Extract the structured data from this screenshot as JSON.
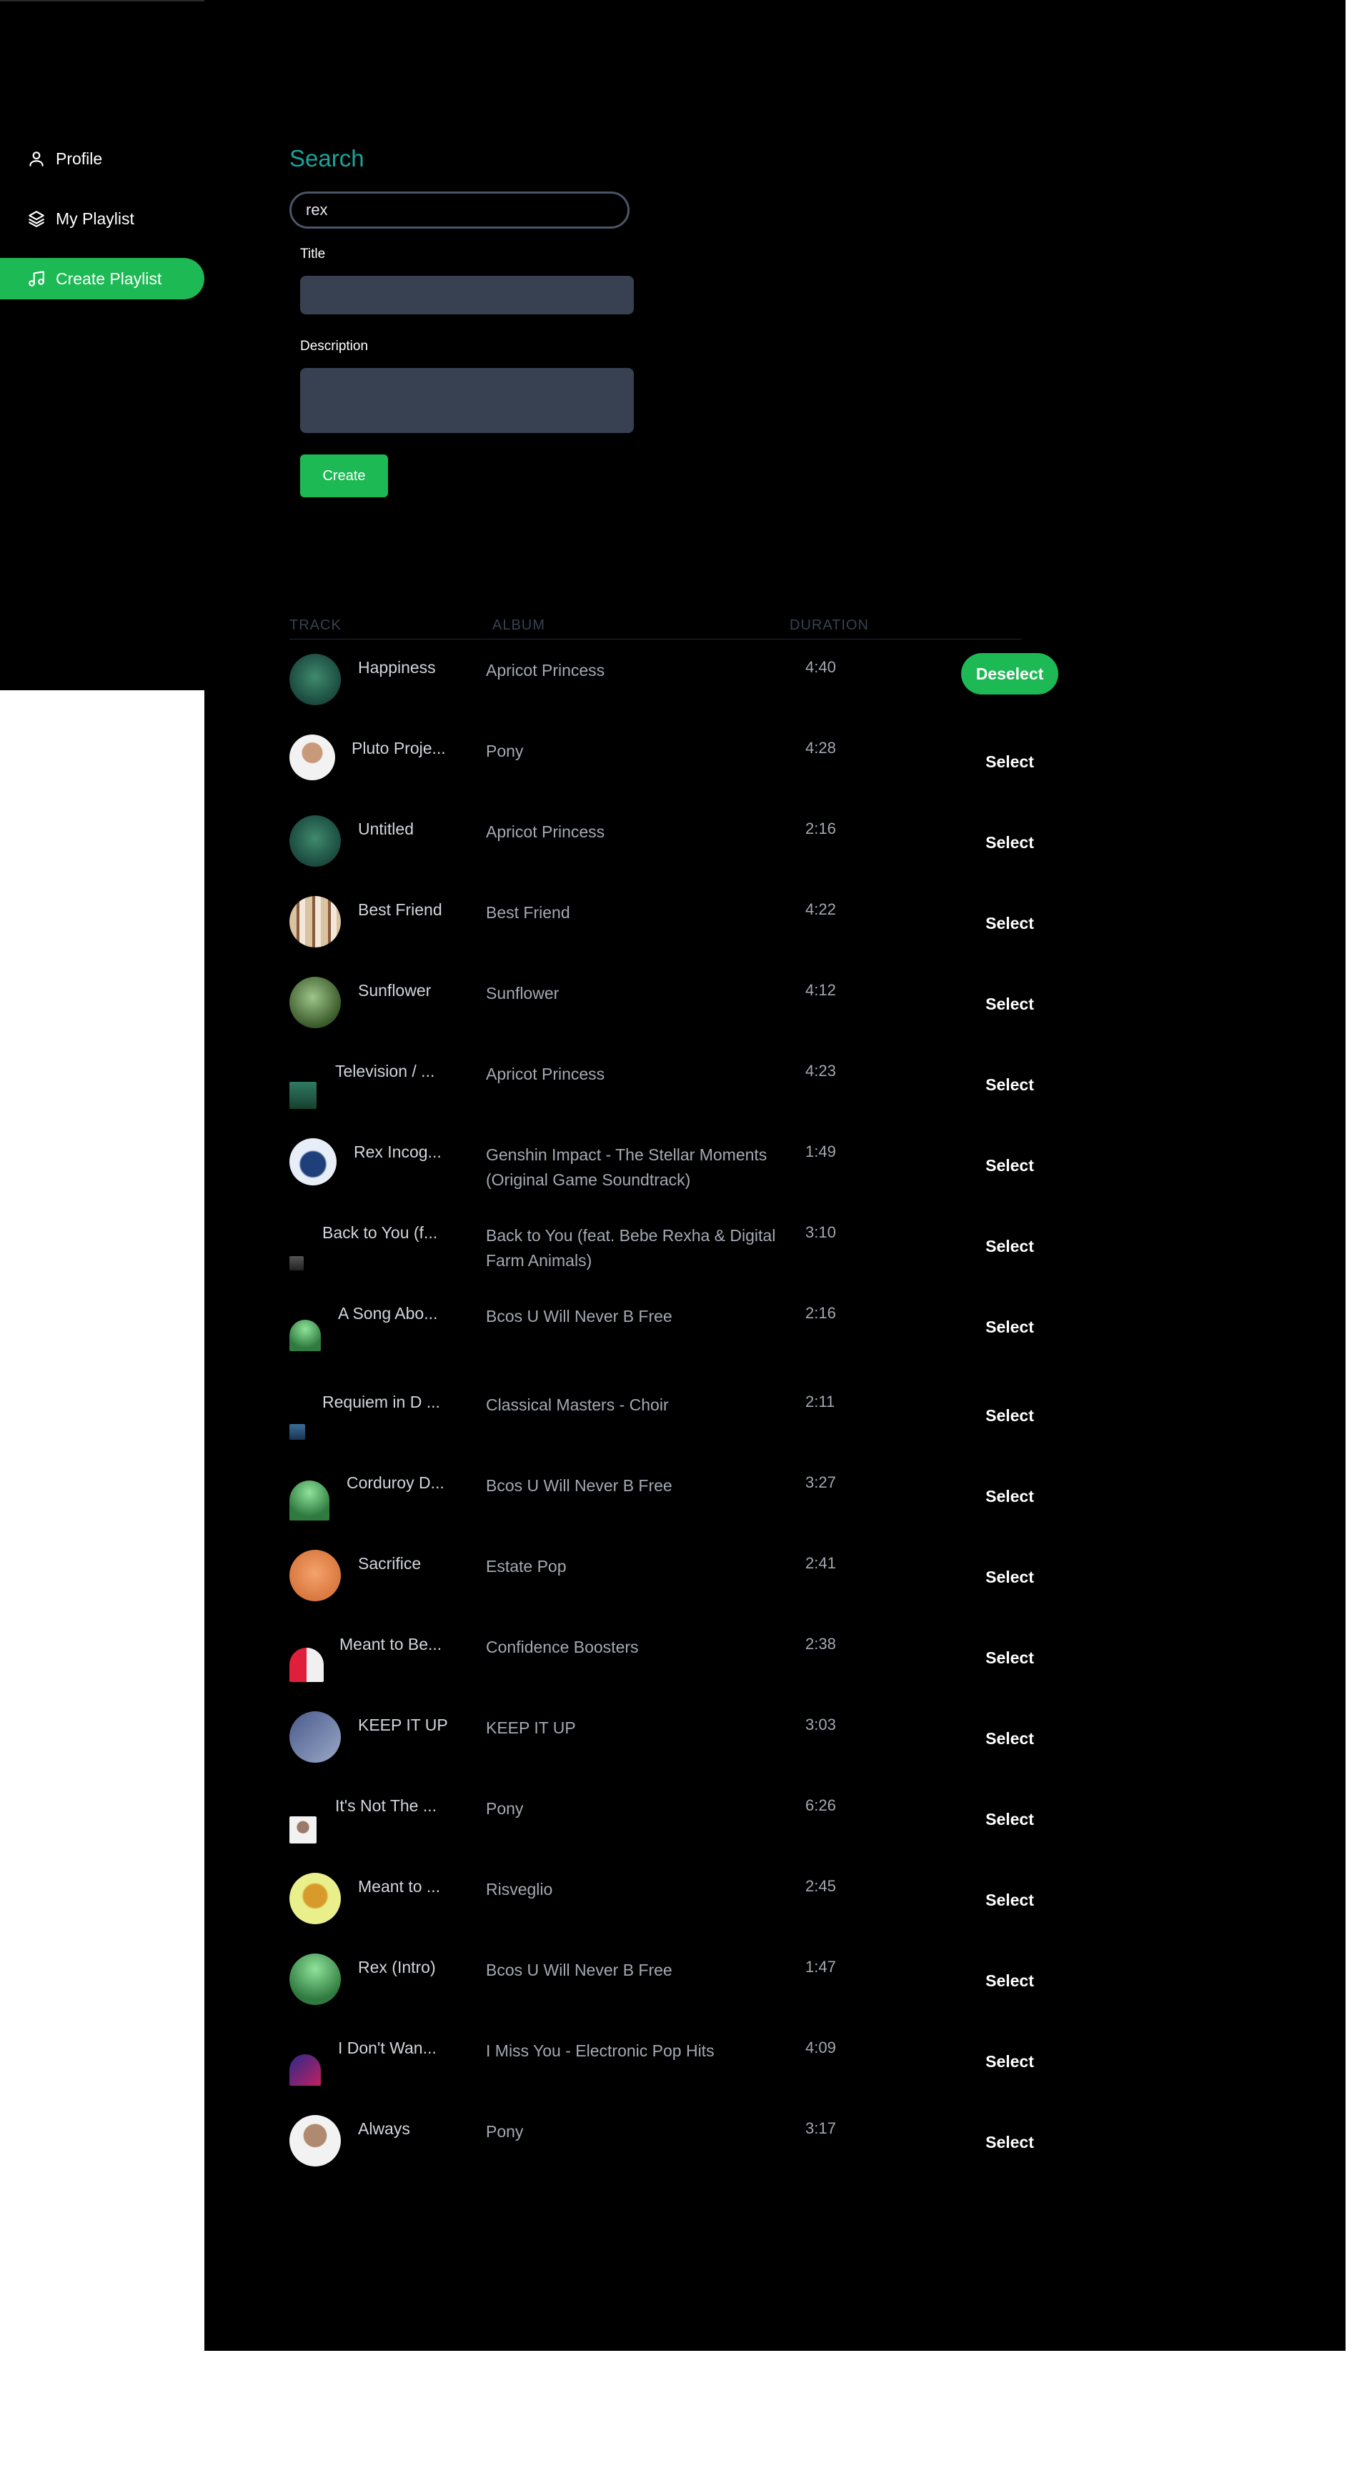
{
  "sidebar": {
    "items": [
      {
        "label": "Profile",
        "icon": "user-icon"
      },
      {
        "label": "My Playlist",
        "icon": "layers-icon"
      },
      {
        "label": "Create Playlist",
        "icon": "music-note-icon",
        "active": true
      }
    ]
  },
  "search": {
    "title": "Search",
    "value": "rex"
  },
  "form": {
    "title_label": "Title",
    "description_label": "Description",
    "create_label": "Create"
  },
  "table": {
    "headers": {
      "track": "TRACK",
      "album": "ALBUM",
      "duration": "DURATION"
    },
    "rows": [
      {
        "title": "Happiness",
        "album": "Apricot Princess",
        "duration": "4:40",
        "action": "Deselect"
      },
      {
        "title": "Pluto Proje...",
        "album": "Pony",
        "duration": "4:28",
        "action": "Select"
      },
      {
        "title": "Untitled",
        "album": "Apricot Princess",
        "duration": "2:16",
        "action": "Select"
      },
      {
        "title": "Best Friend",
        "album": "Best Friend",
        "duration": "4:22",
        "action": "Select"
      },
      {
        "title": "Sunflower",
        "album": "Sunflower",
        "duration": "4:12",
        "action": "Select"
      },
      {
        "title": "Television / ...",
        "album": "Apricot Princess",
        "duration": "4:23",
        "action": "Select"
      },
      {
        "title": "Rex Incog...",
        "album": "Genshin Impact - The Stellar Moments (Original Game Soundtrack)",
        "duration": "1:49",
        "action": "Select"
      },
      {
        "title": "Back to You (f...",
        "album": "Back to You (feat. Bebe Rexha & Digital Farm Animals)",
        "duration": "3:10",
        "action": "Select"
      },
      {
        "title": "A Song Abo...",
        "album": "Bcos U Will Never B Free",
        "duration": "2:16",
        "action": "Select"
      },
      {
        "title": "Requiem in D ...",
        "album": "Classical Masters - Choir",
        "duration": "2:11",
        "action": "Select"
      },
      {
        "title": "Corduroy D...",
        "album": "Bcos U Will Never B Free",
        "duration": "3:27",
        "action": "Select"
      },
      {
        "title": "Sacrifice",
        "album": "Estate Pop",
        "duration": "2:41",
        "action": "Select"
      },
      {
        "title": "Meant to Be...",
        "album": "Confidence Boosters",
        "duration": "2:38",
        "action": "Select"
      },
      {
        "title": "KEEP IT UP",
        "album": "KEEP IT UP",
        "duration": "3:03",
        "action": "Select"
      },
      {
        "title": "It's Not The ...",
        "album": "Pony",
        "duration": "6:26",
        "action": "Select"
      },
      {
        "title": "Meant to ...",
        "album": "Risveglio",
        "duration": "2:45",
        "action": "Select"
      },
      {
        "title": "Rex (Intro)",
        "album": "Bcos U Will Never B Free",
        "duration": "1:47",
        "action": "Select"
      },
      {
        "title": "I Don't Wan...",
        "album": "I Miss You - Electronic Pop Hits",
        "duration": "4:09",
        "action": "Select"
      },
      {
        "title": "Always",
        "album": "Pony",
        "duration": "3:17",
        "action": "Select"
      }
    ]
  },
  "colors": {
    "accent": "#1db954",
    "search_title": "#1aa39a",
    "field": "#374151"
  }
}
